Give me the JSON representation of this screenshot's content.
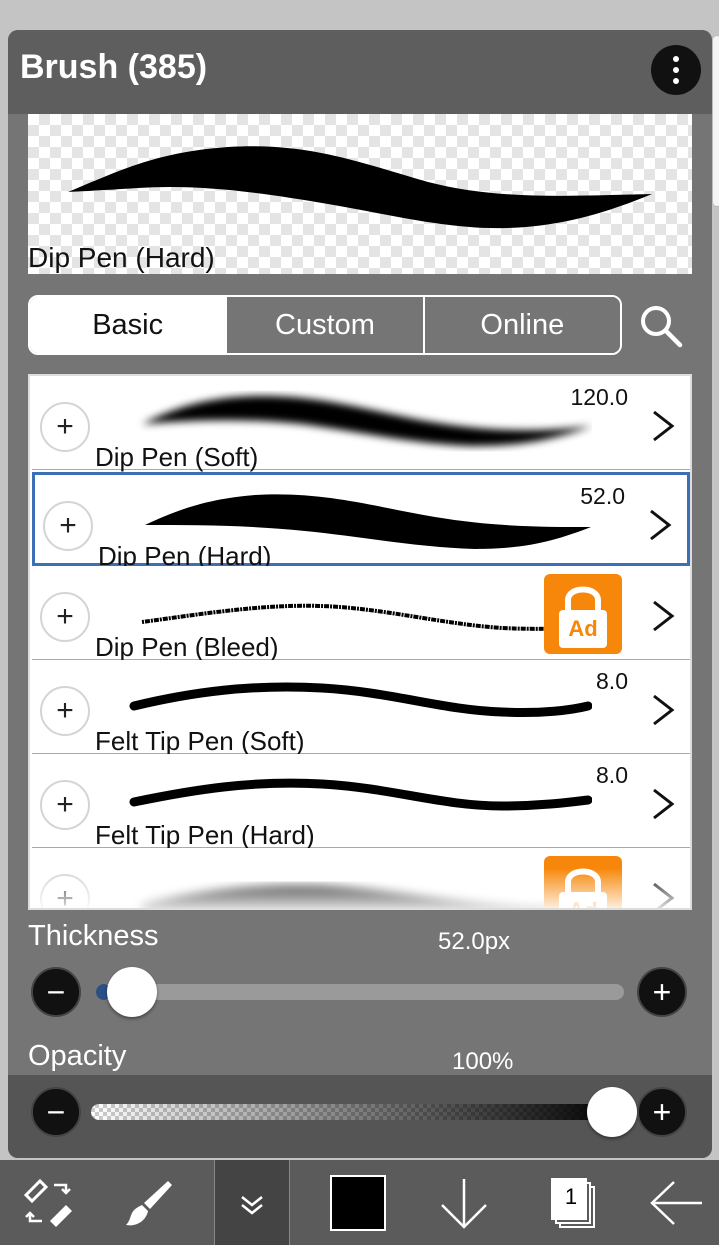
{
  "header": {
    "title": "Brush (385)",
    "menu_icon": "more-vertical-icon"
  },
  "preview": {
    "brush_name": "Dip Pen (Hard)"
  },
  "tabs": [
    {
      "label": "Basic",
      "active": true
    },
    {
      "label": "Custom",
      "active": false
    },
    {
      "label": "Online",
      "active": false
    }
  ],
  "search": {
    "icon": "search-icon"
  },
  "brushes": [
    {
      "name": "Dip Pen (Soft)",
      "size": "120.0",
      "locked": false,
      "selected": false
    },
    {
      "name": "Dip Pen (Hard)",
      "size": "52.0",
      "locked": false,
      "selected": true
    },
    {
      "name": "Dip Pen (Bleed)",
      "size": "",
      "locked": true,
      "lock_text": "Ad",
      "selected": false
    },
    {
      "name": "Felt Tip Pen (Soft)",
      "size": "8.0",
      "locked": false,
      "selected": false
    },
    {
      "name": "Felt Tip Pen (Hard)",
      "size": "8.0",
      "locked": false,
      "selected": false
    },
    {
      "name": "",
      "size": "",
      "locked": true,
      "lock_text": "Ad",
      "selected": false
    }
  ],
  "thickness": {
    "label": "Thickness",
    "value": "52.0px",
    "slider_fraction": 0.05
  },
  "opacity": {
    "label": "Opacity",
    "value": "100%",
    "slider_fraction": 1.0
  },
  "colors": {
    "accent": "#3d6fb6",
    "lock_badge": "#f7870a",
    "current_color": "#000000"
  },
  "toolbar": {
    "items": [
      "transform-icon",
      "brush-icon",
      "collapse-icon",
      "color-swatch",
      "move-down-icon",
      "layers-icon",
      "back-arrow-icon"
    ],
    "layer_count": "1"
  }
}
